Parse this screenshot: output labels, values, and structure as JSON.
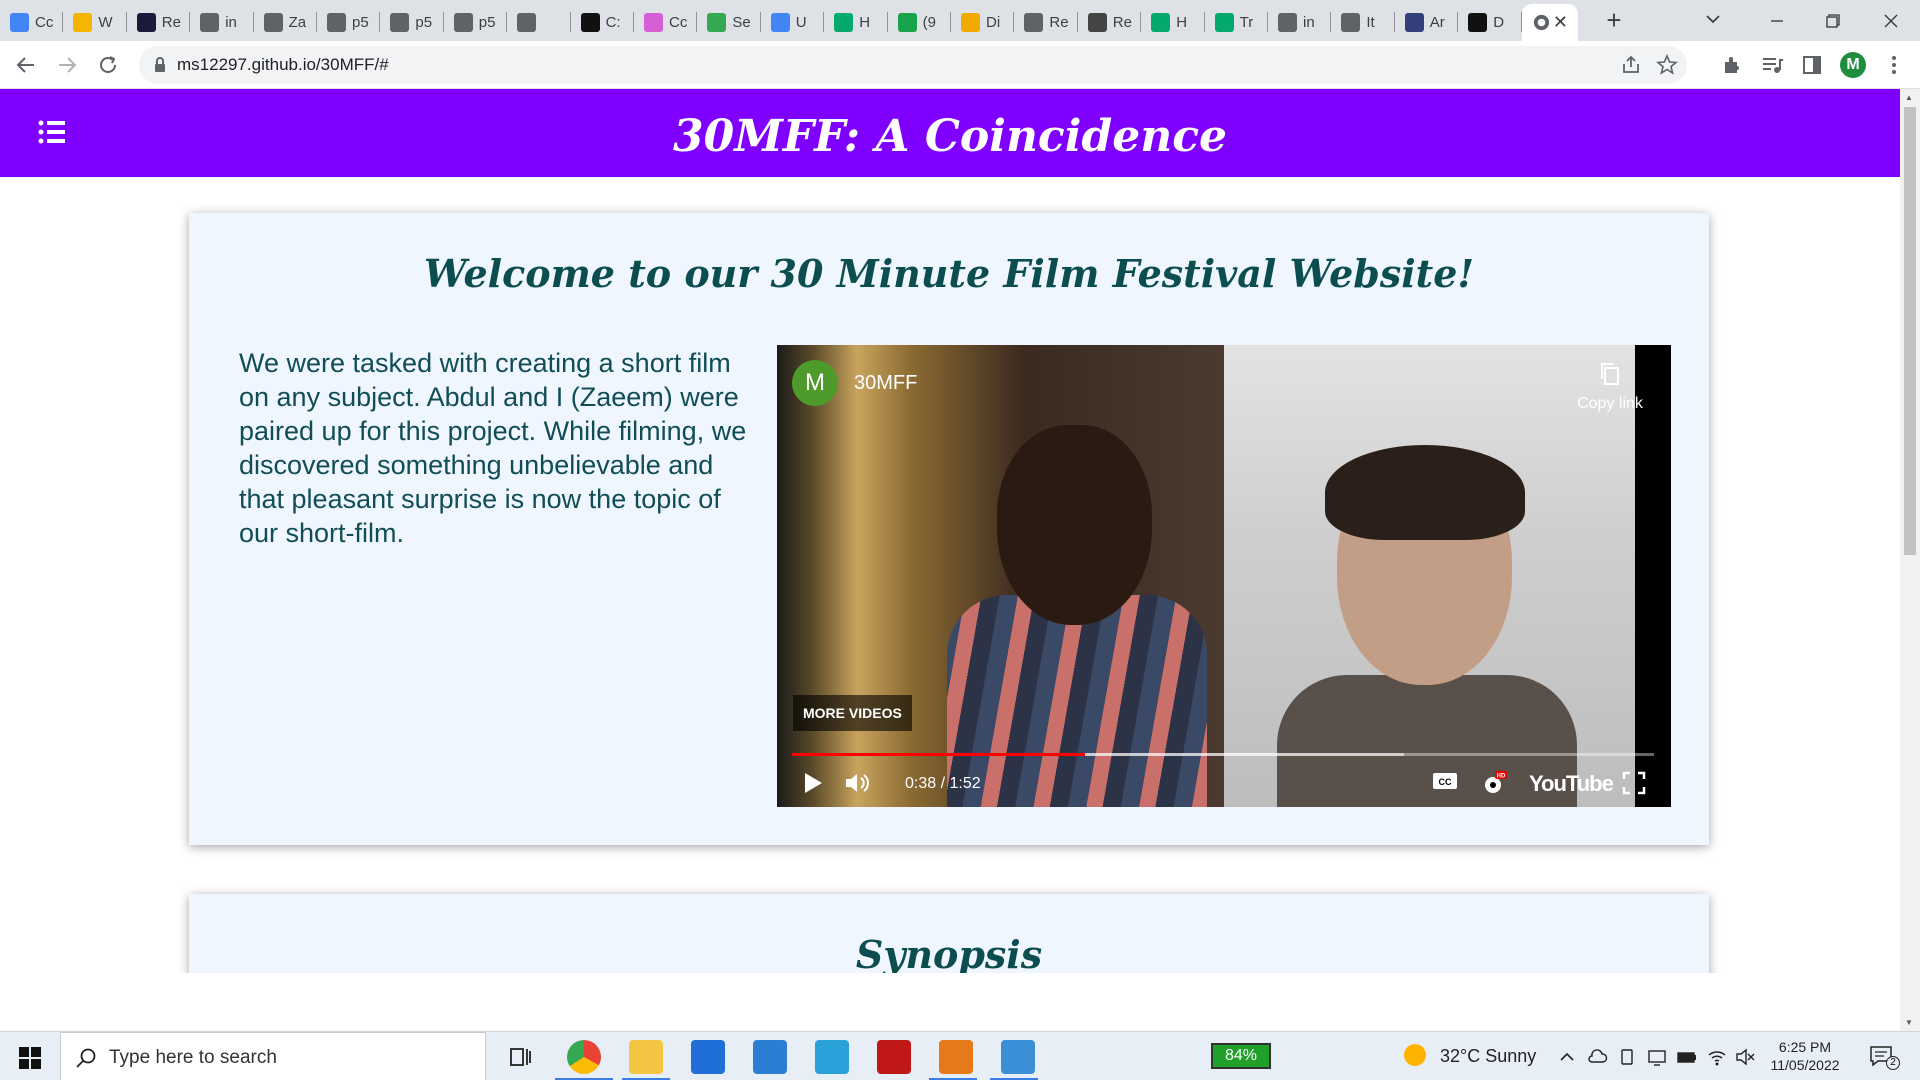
{
  "browser": {
    "tabs": [
      {
        "label": "Cc",
        "icon": "google-docs-icon",
        "color": "#4285f4"
      },
      {
        "label": "W",
        "icon": "google-slides-icon",
        "color": "#f4b400"
      },
      {
        "label": "Re",
        "icon": "app-logo-icon",
        "color": "#1a1a3a"
      },
      {
        "label": "in",
        "icon": "globe-icon",
        "color": "#5f6368"
      },
      {
        "label": "Za",
        "icon": "openai-icon",
        "color": "#5f6368"
      },
      {
        "label": "p5",
        "icon": "globe-icon",
        "color": "#5f6368"
      },
      {
        "label": "p5",
        "icon": "globe-icon",
        "color": "#5f6368"
      },
      {
        "label": "p5",
        "icon": "globe-icon",
        "color": "#5f6368"
      },
      {
        "label": "",
        "icon": "globe-icon",
        "color": "#5f6368"
      },
      {
        "label": "C:",
        "icon": "codesandbox-icon",
        "color": "#111111"
      },
      {
        "label": "Cc",
        "icon": "app-icon",
        "color": "#d65fd6"
      },
      {
        "label": "Se",
        "icon": "google-drive-icon",
        "color": "#34a853"
      },
      {
        "label": "U",
        "icon": "google-docs-icon",
        "color": "#4285f4"
      },
      {
        "label": "H",
        "icon": "w3schools-icon",
        "color": "#04aa6d"
      },
      {
        "label": "(9",
        "icon": "badge-icon",
        "color": "#19a34a"
      },
      {
        "label": "Di",
        "icon": "app-icon",
        "color": "#f2a900"
      },
      {
        "label": "Re",
        "icon": "globe-icon",
        "color": "#5f6368"
      },
      {
        "label": "Re",
        "icon": "cap-icon",
        "color": "#444444"
      },
      {
        "label": "H",
        "icon": "w3schools-icon",
        "color": "#04aa6d"
      },
      {
        "label": "Tr",
        "icon": "w3schools-icon",
        "color": "#04aa6d"
      },
      {
        "label": "in",
        "icon": "globe-icon",
        "color": "#5f6368"
      },
      {
        "label": "It",
        "icon": "globe-icon",
        "color": "#5f6368"
      },
      {
        "label": "Ar",
        "icon": "app-icon",
        "color": "#333f7a"
      },
      {
        "label": "D",
        "icon": "github-icon",
        "color": "#111111"
      }
    ],
    "active_tab": {
      "label": "",
      "icon": "globe-icon",
      "color": "#5f6368"
    },
    "url": "ms12297.github.io/30MFF/#",
    "profile_initial": "M"
  },
  "site": {
    "title": "30MFF: A Coincidence",
    "header_color": "#8000ff",
    "welcome_heading": "Welcome to our 30 Minute Film Festival Website!",
    "intro_text": "We were tasked with creating a short film on any subject. Abdul and I (Zaeem) were paired up for this project. While filming, we discovered something unbelievable and that pleasant surprise is now the topic of our short-film.",
    "synopsis_heading": "Synopsis"
  },
  "video": {
    "channel_initial": "M",
    "channel_name": "30MFF",
    "copy_link_label": "Copy link",
    "more_videos_label": "MORE VIDEOS",
    "time": "0:38 / 1:52",
    "progress_fraction": 0.34,
    "buffer_fraction": 0.71,
    "logo_text": "YouTube"
  },
  "taskbar": {
    "search_placeholder": "Type here to search",
    "battery": "84%",
    "weather": "32°C  Sunny",
    "time": "6:25 PM",
    "date": "11/05/2022",
    "notifications": "2"
  }
}
